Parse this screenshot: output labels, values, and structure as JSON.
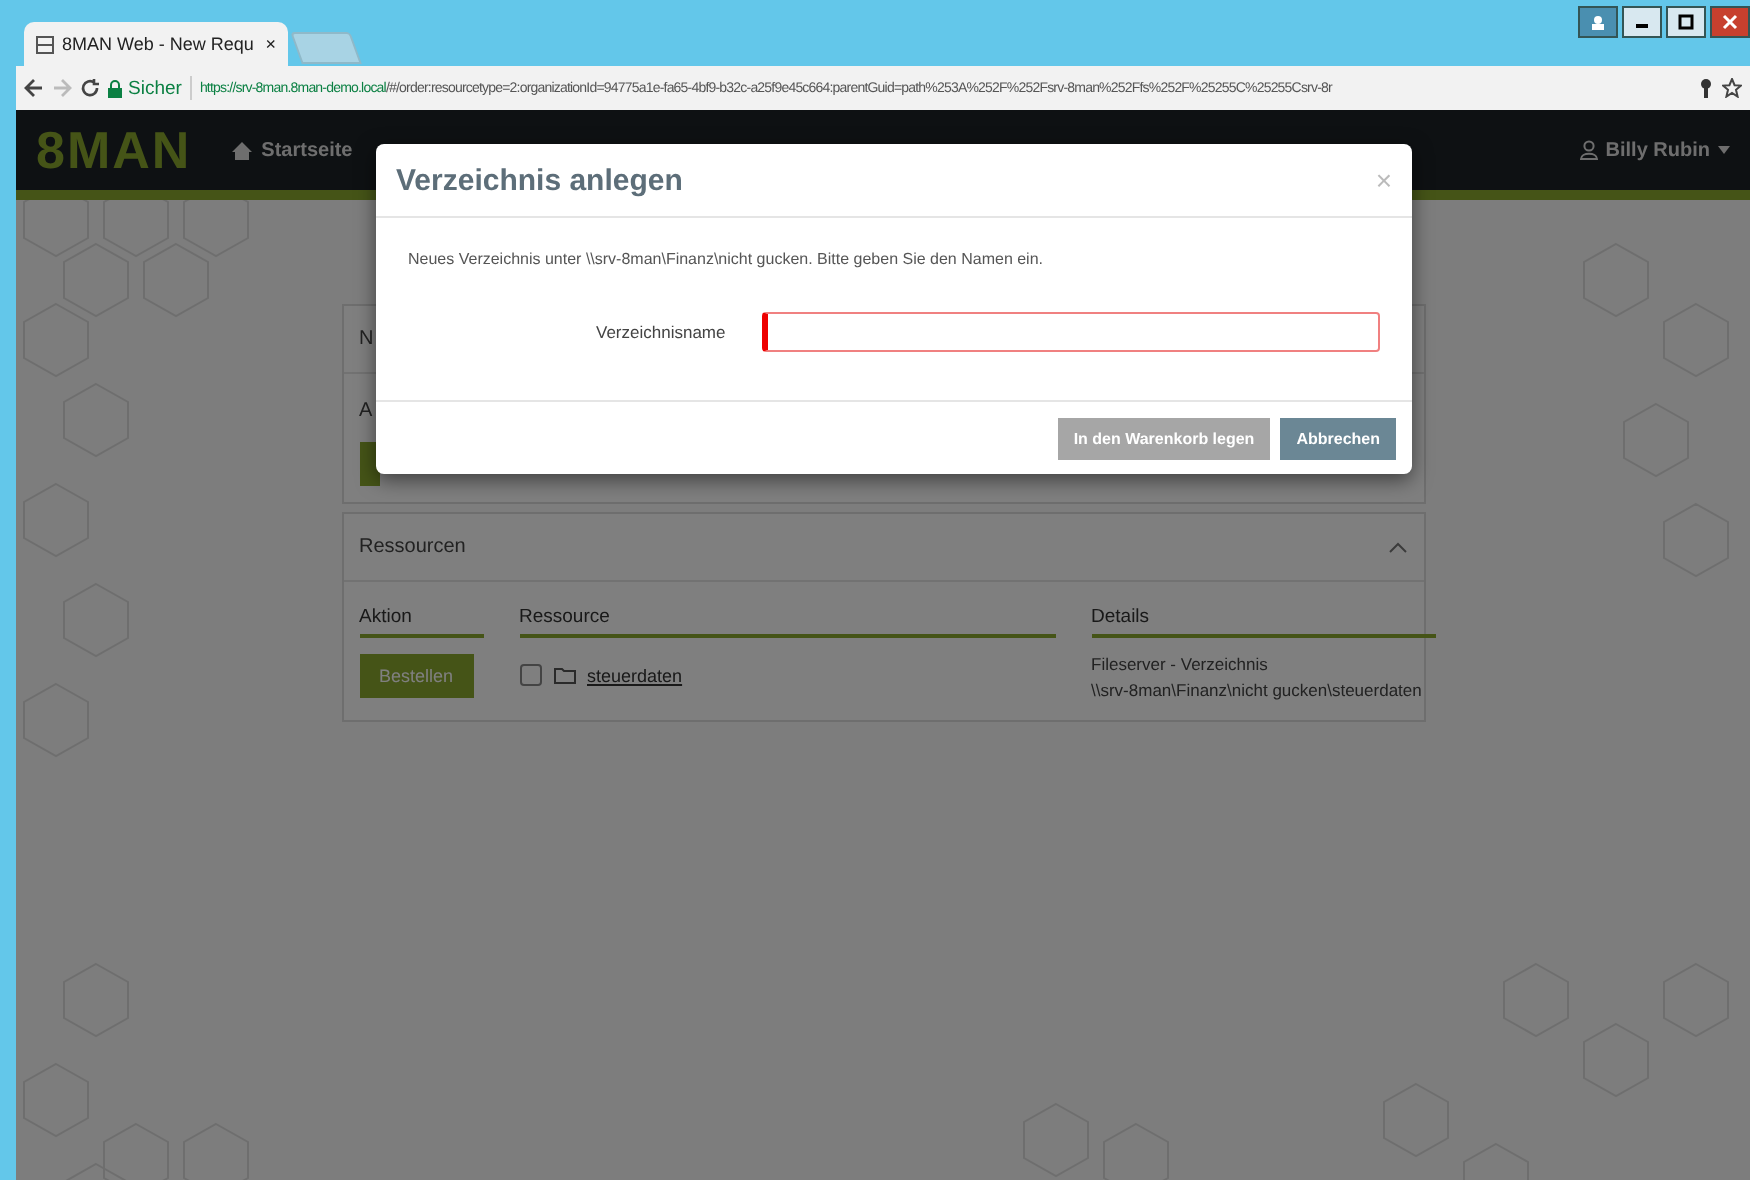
{
  "browser": {
    "tab": {
      "title": "8MAN Web - New Requ",
      "close": "×",
      "selected": true
    },
    "secure_label": "Sicher",
    "url_host": "https://srv-8man.8man-demo.local",
    "url_path": "/#/order:resourcetype=2:organizationId=94775a1e-fa65-4bf9-b32c-a25f9e45c664:parentGuid=path%253A%252F%252Fsrv-8man%252Ffs%252F%25255C%25255Csrv-8r"
  },
  "header": {
    "logo": "8MAN",
    "nav": "Startseite",
    "user": "Billy Rubin"
  },
  "order_card": {
    "heading": "N",
    "column": "A"
  },
  "resources": {
    "title": "Ressourcen",
    "expanded": true,
    "columns": [
      "Aktion",
      "Ressource",
      "Details"
    ],
    "rows": [
      {
        "action": "Bestellen",
        "checked": false,
        "name": "steuerdaten",
        "details": [
          "Fileserver - Verzeichnis",
          "\\\\srv-8man\\Finanz\\nicht gucken\\steuerdaten"
        ]
      }
    ]
  },
  "modal": {
    "title": "Verzeichnis anlegen",
    "close": "×",
    "message": "Neues Verzeichnis unter \\\\srv-8man\\Finanz\\nicht gucken. Bitte geben Sie den Namen ein.",
    "field_label": "Verzeichnisname",
    "invalid": true,
    "buttons": [
      {
        "label": "In den Warenkorb legen",
        "disabled": true
      },
      {
        "label": "Abbrechen",
        "disabled": false
      }
    ]
  }
}
